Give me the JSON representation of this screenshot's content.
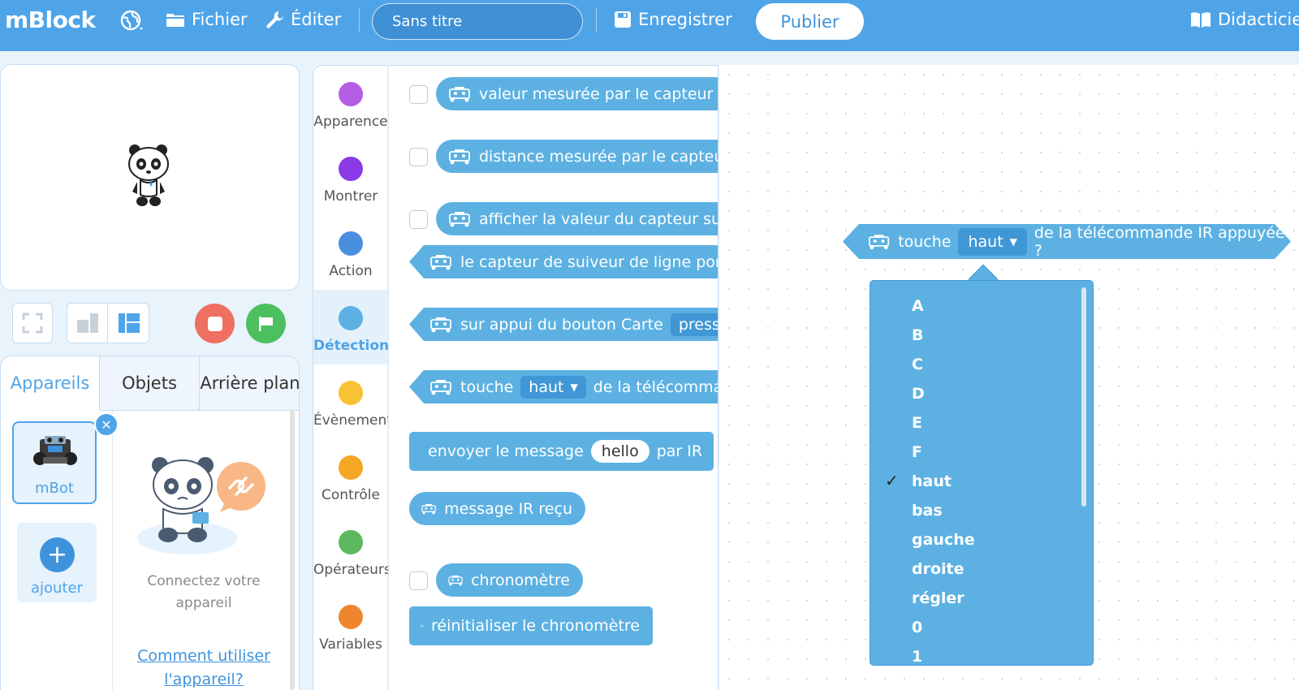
{
  "topbar": {
    "brand": "mBlock",
    "file_label": "Fichier",
    "edit_label": "Éditer",
    "project_title": "Sans titre",
    "save_label": "Enregistrer",
    "publish_label": "Publier",
    "tutorial_label": "Didacticiel"
  },
  "device_tabs": [
    "Appareils",
    "Objets",
    "Arrière plan"
  ],
  "device": {
    "name": "mBot",
    "add_label": "ajouter",
    "connect_text_1": "Connectez votre",
    "connect_text_2": "appareil",
    "help_link_1": "Comment utiliser",
    "help_link_2": "l'appareil?"
  },
  "categories": [
    {
      "label": "Apparence",
      "color": "#b35ee4"
    },
    {
      "label": "Montrer",
      "color": "#8a3ae6"
    },
    {
      "label": "Action",
      "color": "#4a8ee0"
    },
    {
      "label": "Détection",
      "color": "#5cb1e2"
    },
    {
      "label": "Évènement",
      "color": "#f7c233"
    },
    {
      "label": "Contrôle",
      "color": "#f5a623"
    },
    {
      "label": "Opérateurs",
      "color": "#5cb85c"
    },
    {
      "label": "Variables",
      "color": "#f0852f"
    }
  ],
  "blocks": {
    "b1": "valeur mesurée par le capteur de",
    "b2": "distance mesurée par le capteur",
    "b3": "afficher la valeur du capteur suiv",
    "b4": "le capteur de suiveur de ligne port",
    "b5": "sur appui du bouton Carte",
    "b5_drop": "pressé",
    "b6_pre": "touche",
    "b6_drop": "haut",
    "b6_post": "de la télécomman",
    "b7_pre": "envoyer le message",
    "b7_input": "hello",
    "b7_post": "par IR",
    "b8": "message IR reçu",
    "b9": "chronomètre",
    "b10": "réinitialiser le chronomètre"
  },
  "workspace_block": {
    "pre": "touche",
    "drop": "haut",
    "post": "de la télécommande IR appuyée ?"
  },
  "dropdown": {
    "selected": "haut",
    "options": [
      "A",
      "B",
      "C",
      "D",
      "E",
      "F",
      "haut",
      "bas",
      "gauche",
      "droite",
      "régler",
      "0",
      "1"
    ]
  },
  "colors": {
    "topbar": "#4fa4e8",
    "sensing_block": "#5cb1e2",
    "stop": "#ef6f62",
    "go": "#4cbf5f"
  }
}
